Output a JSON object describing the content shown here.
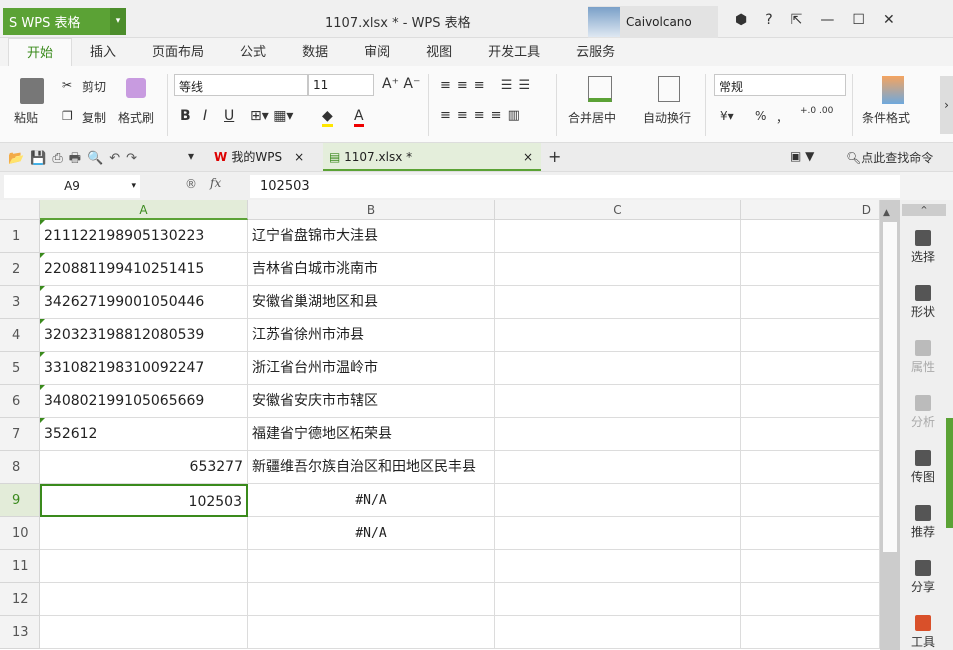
{
  "app": {
    "logo": "S WPS 表格",
    "window_title": "1107.xlsx * - WPS 表格",
    "user": "Caivolcano"
  },
  "menu_tabs": [
    "开始",
    "插入",
    "页面布局",
    "公式",
    "数据",
    "审阅",
    "视图",
    "开发工具",
    "云服务"
  ],
  "ribbon": {
    "paste": "粘贴",
    "cut": "剪切",
    "copy": "复制",
    "format_painter": "格式刷",
    "font": "等线",
    "size": "11",
    "bold": "B",
    "italic": "I",
    "underline": "U",
    "merge": "合并居中",
    "wrap": "自动换行",
    "number_format": "常规",
    "percent": "%",
    "comma": "，",
    "cond_format": "条件格式"
  },
  "doc_tabs": {
    "home": "我的WPS",
    "file": "1107.xlsx *",
    "search": "点此查找命令"
  },
  "formula_bar": {
    "name_box": "A9",
    "fx": "fx",
    "value": "102503"
  },
  "columns": [
    "A",
    "B",
    "C",
    "D"
  ],
  "rows": [
    {
      "n": "1",
      "a": "211122198905130223",
      "b": "辽宁省盘锦市大洼县",
      "num": false
    },
    {
      "n": "2",
      "a": "220881199410251415",
      "b": "吉林省白城市洮南市",
      "num": false
    },
    {
      "n": "3",
      "a": "342627199001050446",
      "b": "安徽省巢湖地区和县",
      "num": false
    },
    {
      "n": "4",
      "a": "320323198812080539",
      "b": "江苏省徐州市沛县",
      "num": false
    },
    {
      "n": "5",
      "a": "331082198310092247",
      "b": "浙江省台州市温岭市",
      "num": false
    },
    {
      "n": "6",
      "a": "340802199105065669",
      "b": "安徽省安庆市市辖区",
      "num": false
    },
    {
      "n": "7",
      "a": "352612",
      "b": "福建省宁德地区柘荣县",
      "num": false
    },
    {
      "n": "8",
      "a": "653277",
      "b": "新疆维吾尔族自治区和田地区民丰县",
      "num": true
    },
    {
      "n": "9",
      "a": "102503",
      "b": "#N/A",
      "num": true
    },
    {
      "n": "10",
      "a": "",
      "b": "#N/A",
      "num": false
    },
    {
      "n": "11",
      "a": "",
      "b": "",
      "num": false
    },
    {
      "n": "12",
      "a": "",
      "b": "",
      "num": false
    },
    {
      "n": "13",
      "a": "",
      "b": "",
      "num": false
    }
  ],
  "sidebar": [
    {
      "label": "选择",
      "disabled": false
    },
    {
      "label": "形状",
      "disabled": false
    },
    {
      "label": "属性",
      "disabled": true
    },
    {
      "label": "分析",
      "disabled": true
    },
    {
      "label": "传图",
      "disabled": false
    },
    {
      "label": "推荐",
      "disabled": false
    },
    {
      "label": "分享",
      "disabled": false
    },
    {
      "label": "工具",
      "disabled": false
    }
  ],
  "colors": {
    "accent": "#5ba235"
  }
}
